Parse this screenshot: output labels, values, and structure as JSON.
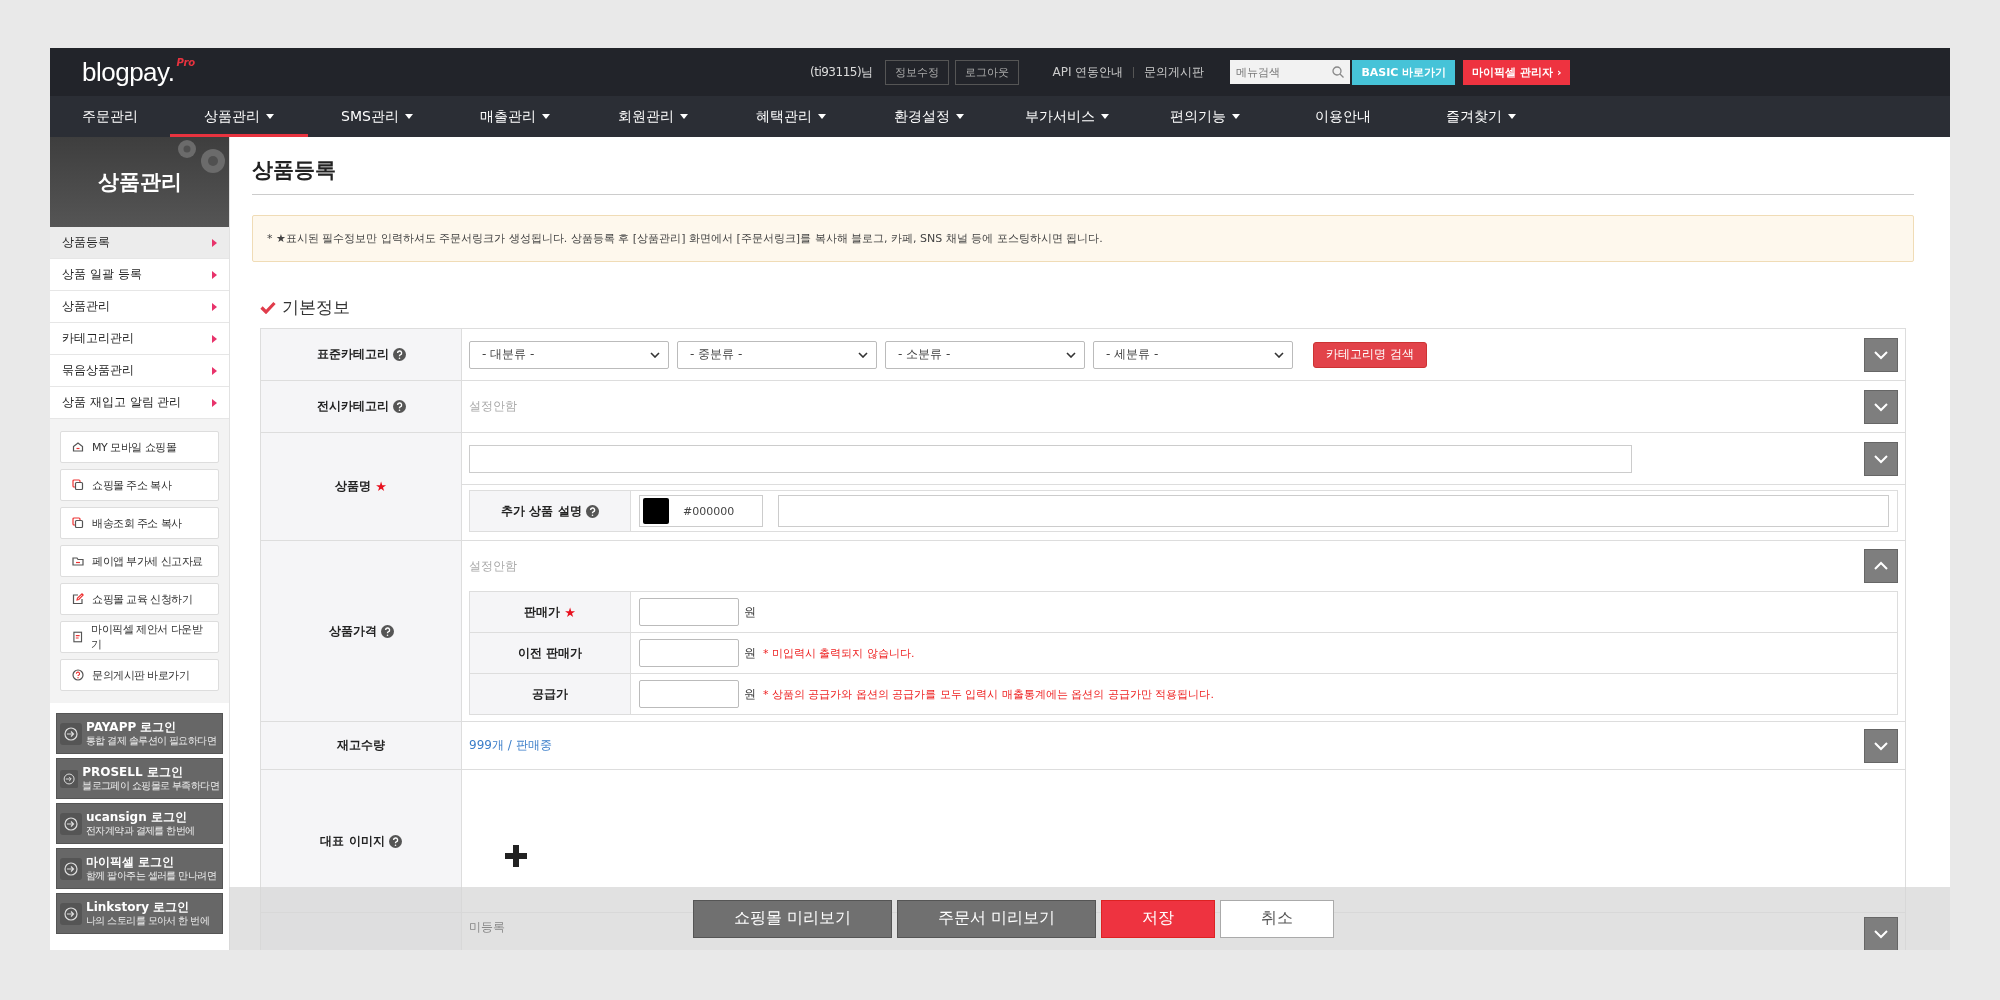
{
  "header": {
    "logo": {
      "main": "blogpay.",
      "badge": "Pro"
    },
    "user": "(ti93115)님",
    "user_buttons": [
      "정보수정",
      "로그아웃"
    ],
    "links": [
      "API 연동안내",
      "문의게시판"
    ],
    "search": {
      "placeholder": "메뉴검색"
    },
    "actions": [
      {
        "label": "BASIC 바로가기",
        "kind": "basic"
      },
      {
        "label": "마이픽셀 관리자 ›",
        "kind": "admin"
      }
    ]
  },
  "nav": [
    {
      "label": "주문관리",
      "dropdown": false,
      "selected": false
    },
    {
      "label": "상품관리",
      "dropdown": true,
      "selected": true
    },
    {
      "label": "SMS관리",
      "dropdown": true,
      "selected": false
    },
    {
      "label": "매출관리",
      "dropdown": true,
      "selected": false
    },
    {
      "label": "회원관리",
      "dropdown": true,
      "selected": false
    },
    {
      "label": "혜택관리",
      "dropdown": true,
      "selected": false
    },
    {
      "label": "환경설정",
      "dropdown": true,
      "selected": false
    },
    {
      "label": "부가서비스",
      "dropdown": true,
      "selected": false
    },
    {
      "label": "편의기능",
      "dropdown": true,
      "selected": false
    },
    {
      "label": "이용안내",
      "dropdown": false,
      "selected": false
    },
    {
      "label": "즐겨찾기",
      "dropdown": true,
      "selected": false
    }
  ],
  "sidebar": {
    "title": "상품관리",
    "items": [
      {
        "label": "상품등록",
        "selected": true
      },
      {
        "label": "상품 일괄 등록",
        "selected": false
      },
      {
        "label": "상품관리",
        "selected": false
      },
      {
        "label": "카테고리관리",
        "selected": false
      },
      {
        "label": "묶음상품관리",
        "selected": false
      },
      {
        "label": "상품 재입고 알림 관리",
        "selected": false
      }
    ],
    "quick_links": [
      "MY 모바일 쇼핑몰",
      "쇼핑몰 주소 복사",
      "배송조회 주소 복사",
      "페이앱 부가세 신고자료",
      "쇼핑몰 교육 신청하기",
      "마이픽셀 제안서 다운받기",
      "문의게시판 바로가기"
    ],
    "logins": [
      {
        "title": "PAYAPP 로그인",
        "subtitle": "통합 결제 솔루션이 필요하다면"
      },
      {
        "title": "PROSELL 로그인",
        "subtitle": "블로그페이 쇼핑몰로 부족하다면"
      },
      {
        "title": "ucansign 로그인",
        "subtitle": "전자계약과 결제를 한번에"
      },
      {
        "title": "마이픽셀 로그인",
        "subtitle": "함께 팔아주는 셀러를 만나려면"
      },
      {
        "title": "Linkstory 로그인",
        "subtitle": "나의 스토리를 모아서 한 번에"
      }
    ]
  },
  "page": {
    "title": "상품등록",
    "notice": "* **★**표시된 필수정보만 입력하셔도 주문서링크가 생성됩니다. 상품등록 후 [상품관리] 화면에서 [주문서링크]를 복사해 블로그, 카페, SNS 채널 등에 포스팅하시면 됩니다.",
    "section": "기본정보",
    "rows": [
      {
        "kind": "selects",
        "label": "표준카테고리",
        "help": true,
        "expanded": false,
        "selects": [
          "- 대분류 -",
          "- 중분류 -",
          "- 소분류 -",
          "- 세분류 -"
        ],
        "button": "카테고리명 검색"
      },
      {
        "kind": "text",
        "label": "전시카테고리",
        "help": true,
        "expanded": false,
        "value": "설정안함"
      },
      {
        "kind": "name",
        "label": "상품명",
        "help": false,
        "required_mark": "★",
        "expanded": false,
        "sub_label": "추가 상품 설명",
        "sub_help": true,
        "color_value": "#000000"
      },
      {
        "kind": "price",
        "label": "상품가격",
        "help": true,
        "expanded": true,
        "value": "설정안함",
        "prices": [
          {
            "label": "판매가",
            "required_mark": "★",
            "unit": "원"
          },
          {
            "label": "이전 판매가",
            "unit": "원",
            "note": "* 미입력시 출력되지 않습니다."
          },
          {
            "label": "공급가",
            "unit": "원",
            "note": "* 상품의 공급가와 옵션의 공급가를 모두 입력시 매출통계에는 옵션의 공급가만 적용됩니다."
          }
        ]
      },
      {
        "kind": "stock",
        "label": "재고수량",
        "help": false,
        "expanded": false,
        "value": "999개 / 판매중"
      },
      {
        "kind": "image",
        "label": "대표 이미지",
        "help": true
      },
      {
        "kind": "text",
        "value": "미등록",
        "expanded": false
      }
    ]
  },
  "action_bar": [
    {
      "label": "쇼핑몰 미리보기",
      "kind": "secondary"
    },
    {
      "label": "주문서 미리보기",
      "kind": "secondary"
    },
    {
      "label": "저장",
      "kind": "primary"
    },
    {
      "label": "취소",
      "kind": "cancel"
    }
  ]
}
